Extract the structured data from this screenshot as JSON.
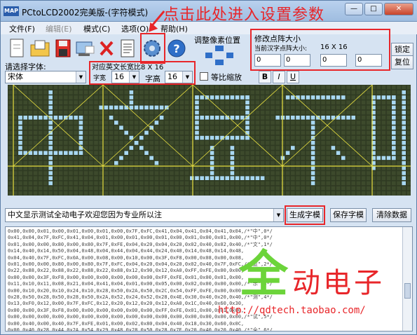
{
  "window": {
    "title": "PCtoLCD2002完美版-(字符模式)",
    "app_icon": "MAP",
    "annotation": "点击此处进入设置参数"
  },
  "menu": {
    "items": [
      {
        "label": "文件(F)",
        "enabled": true
      },
      {
        "label": "编辑(E)",
        "enabled": false
      },
      {
        "label": "模式(C)",
        "enabled": true
      },
      {
        "label": "选项(O)",
        "enabled": true
      },
      {
        "label": "帮助(H)",
        "enabled": true
      }
    ]
  },
  "toolbar": {
    "icons": [
      "new-file-icon",
      "open-folder-icon",
      "save-disk-icon",
      "image-import-icon",
      "delete-x-icon",
      "document-icon",
      "settings-gear-icon",
      "help-icon"
    ]
  },
  "pixel_adjust": {
    "label": "调整像素位置"
  },
  "dot_size": {
    "label": "修改点阵大小",
    "sub_label": "当前汉字点阵大小:",
    "value": "16 X 16",
    "spinners": [
      "0",
      "0",
      "0",
      "0"
    ]
  },
  "side_buttons": {
    "lock": "锁定",
    "reset": "复位"
  },
  "font_select": {
    "label": "请选择字体:",
    "value": "宋体"
  },
  "char_size": {
    "label": "对应英文长宽比8 X 16",
    "width_label": "字宽",
    "width_value": "16",
    "height_label": "字高",
    "height_value": "16",
    "proportional_label": "等比缩放",
    "proportional_checked": false
  },
  "format": {
    "bold": "B",
    "italic": "I",
    "underline": "U"
  },
  "preview_text": "中文显示测试全动电子欢迎您因为专业所以注",
  "buttons": {
    "generate": "生成字模",
    "save": "保存字模",
    "clear": "清除数据"
  },
  "output_lines": [
    "0x00,0x00,0x01,0x00,0x01,0x00,0x01,0x00,0x7F,0xFC,0x41,0x04,0x41,0x04,0x41,0x04,/*\"中\",0*/",
    "0x41,0x04,0x7F,0xFC,0x41,0x04,0x01,0x00,0x01,0x00,0x01,0x00,0x01,0x00,0x01,0x00,/*\"中\",0*/",
    "0x01,0x00,0x00,0x80,0x00,0x80,0x7F,0xFE,0x04,0x20,0x04,0x20,0x02,0x40,0x02,0x40,/*\"文\",1*/",
    "0x14,0x40,0x14,0x50,0x04,0x48,0x04,0x44,0x04,0x44,0x24,0x40,0x14,0x48,0x14,0x48,",
    "0x04,0x40,0x7F,0xFC,0x0A,0x00,0x08,0x00,0x10,0x00,0x3F,0xF8,0x00,0x08,0x00,0x08,",
    "0x01,0x00,0x00,0x80,0x00,0x80,0x7F,0xFC,0x04,0x20,0x04,0x20,0x02,0x40,0x7F,0xFC,/*\"显\",2*/",
    "0x22,0x88,0x22,0x88,0x22,0x88,0x22,0x88,0x12,0x90,0x12,0xA0,0xFF,0xFE,0x00,0x00,",
    "0x00,0x00,0x3F,0xF8,0x00,0x00,0x00,0x00,0x00,0x00,0xFF,0xFE,0x01,0x00,0x01,0x00,",
    "0x11,0x10,0x11,0x08,0x21,0x04,0x41,0x04,0x01,0x00,0x05,0x00,0x02,0x00,0x00,0x00,/*\"示\",3*/",
    "0x00,0x10,0x20,0x10,0x24,0x10,0x28,0x50,0x2A,0x50,0x2C,0x54,0xFF,0xFE,0x00,0x00,",
    "0x28,0x50,0x28,0x50,0x28,0x50,0x2A,0x52,0x24,0x52,0x28,0x4E,0x30,0x40,0x20,0x40,/*\"测\",4*/",
    "0x13,0xF0,0x12,0x00,0x7F,0xFC,0x12,0x20,0x12,0x20,0x12,0xA0,0x1C,0x40,0x60,0x30,",
    "0x00,0x00,0x3F,0xF8,0x00,0x00,0x00,0x00,0x00,0x00,0xFF,0xFE,0x01,0x00,0x01,0x00,",
    "0x00,0x00,0x00,0x00,0x00,0x00,0x00,0x00,0x00,0x00,0x00,0x00,0x00,0x00,0x00,0x00,/*\"试\",5*/",
    "0x00,0x40,0x00,0x40,0x7F,0xFE,0x01,0x00,0x02,0x80,0x04,0x40,0x18,0x30,0x60,0x0C,",
    "0x00,0x40,0x28,0x44,0x2A,0x54,0x29,0x48,0x28,0x50,0x28,0x7E,0x20,0x40,0x20,0x40,/*\"全\",6*/",
    "0x01,0x00,0x01,0x00,0x3F,0xF8,0x21,0x08,0x21,0x08,0x3F,0xF8,0x21,0x08,0x21,0x08,",
    "0x3F,0xF8,0x21,0x0A,0x01,0x02,0x01,0x02,0x00,0xFE,0x00,0x00,0x00,0x00,0x00,0x00,/*\"电\",7*/"
  ],
  "watermark": {
    "big_char": "全",
    "text": "动电子",
    "url": "http://qdtech.taobao.com/"
  },
  "colors": {
    "grid_background": "#2f3a22",
    "grid_cell": "#3d4a2c",
    "grid_on": "#a9d8f2",
    "grid_divider": "#e8e040",
    "annotation_red": "#e8262a",
    "watermark_green": "#6cd43a"
  }
}
